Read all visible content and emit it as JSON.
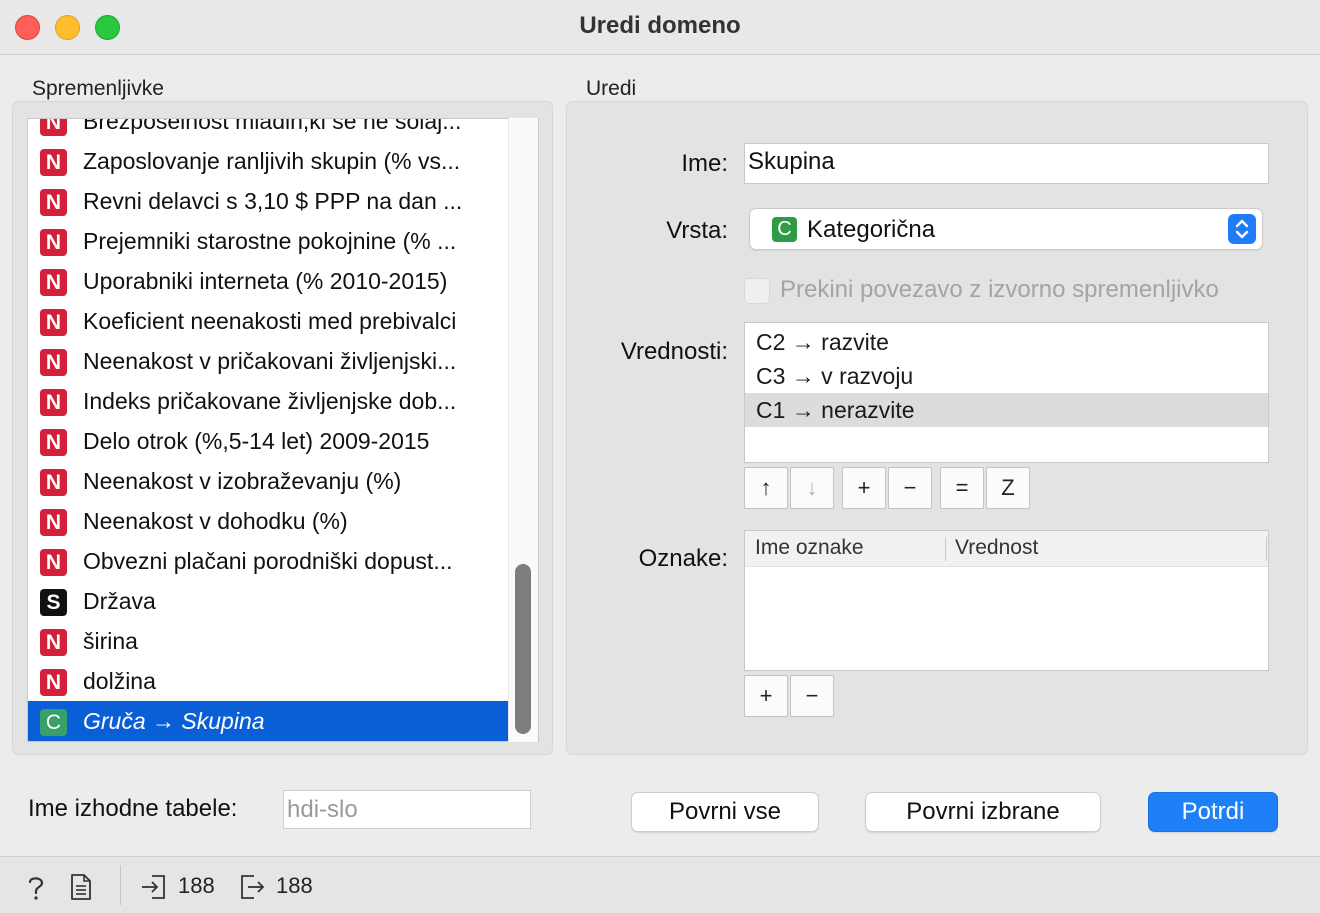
{
  "window": {
    "title": "Uredi domeno"
  },
  "variables": {
    "section_label": "Spremenljivke",
    "items": [
      {
        "type": "N",
        "label": "Brezposelnost mladih,ki se ne šolaj..."
      },
      {
        "type": "N",
        "label": "Zaposlovanje ranljivih skupin (% vs..."
      },
      {
        "type": "N",
        "label": "Revni delavci s 3,10 $ PPP na dan ..."
      },
      {
        "type": "N",
        "label": "Prejemniki starostne pokojnine (% ..."
      },
      {
        "type": "N",
        "label": "Uporabniki interneta (% 2010-2015)"
      },
      {
        "type": "N",
        "label": "Koeficient neenakosti med prebivalci"
      },
      {
        "type": "N",
        "label": "Neenakost v pričakovani življenjski..."
      },
      {
        "type": "N",
        "label": "Indeks pričakovane življenjske dob..."
      },
      {
        "type": "N",
        "label": "Delo otrok (%,5-14 let) 2009-2015"
      },
      {
        "type": "N",
        "label": "Neenakost v izobraževanju (%)"
      },
      {
        "type": "N",
        "label": "Neenakost v dohodku (%)"
      },
      {
        "type": "N",
        "label": "Obvezni plačani porodniški dopust..."
      },
      {
        "type": "S",
        "label": "Država"
      },
      {
        "type": "N",
        "label": "širina"
      },
      {
        "type": "N",
        "label": "dolžina"
      },
      {
        "type": "C",
        "label": "Gruča → Skupina"
      }
    ]
  },
  "editor": {
    "section_label": "Uredi",
    "name_label": "Ime:",
    "name_value": "Skupina",
    "type_label": "Vrsta:",
    "type_badge": "C",
    "type_value": "Kategorična",
    "type_arrow": "▲▼",
    "unlink_label": "Prekini povezavo z izvorno spremenljivko",
    "values_label": "Vrednosti:",
    "values": [
      "C2 → razvite",
      "C3 → v razvoju",
      "C1 → nerazvite"
    ],
    "value_buttons": {
      "up": "↑",
      "down": "↓",
      "add": "+",
      "remove": "−",
      "merge": "=",
      "z": "Z"
    },
    "labels_label": "Oznake:",
    "labels_columns": [
      "Ime oznake",
      "Vrednost"
    ],
    "label_buttons": {
      "add": "+",
      "remove": "−"
    }
  },
  "footer": {
    "output_label": "Ime izhodne tabele:",
    "output_placeholder": "hdi-slo",
    "reset_all": "Povrni vse",
    "reset_selected": "Povrni izbrane",
    "apply": "Potrdi"
  },
  "status": {
    "input_count": "188",
    "output_count": "188"
  },
  "colors": {
    "numeric_badge": "#d3203b",
    "string_badge": "#111111",
    "categorical_badge": "#2f9b46",
    "selection": "#0a5fd6",
    "primary_button": "#1e80f7"
  }
}
